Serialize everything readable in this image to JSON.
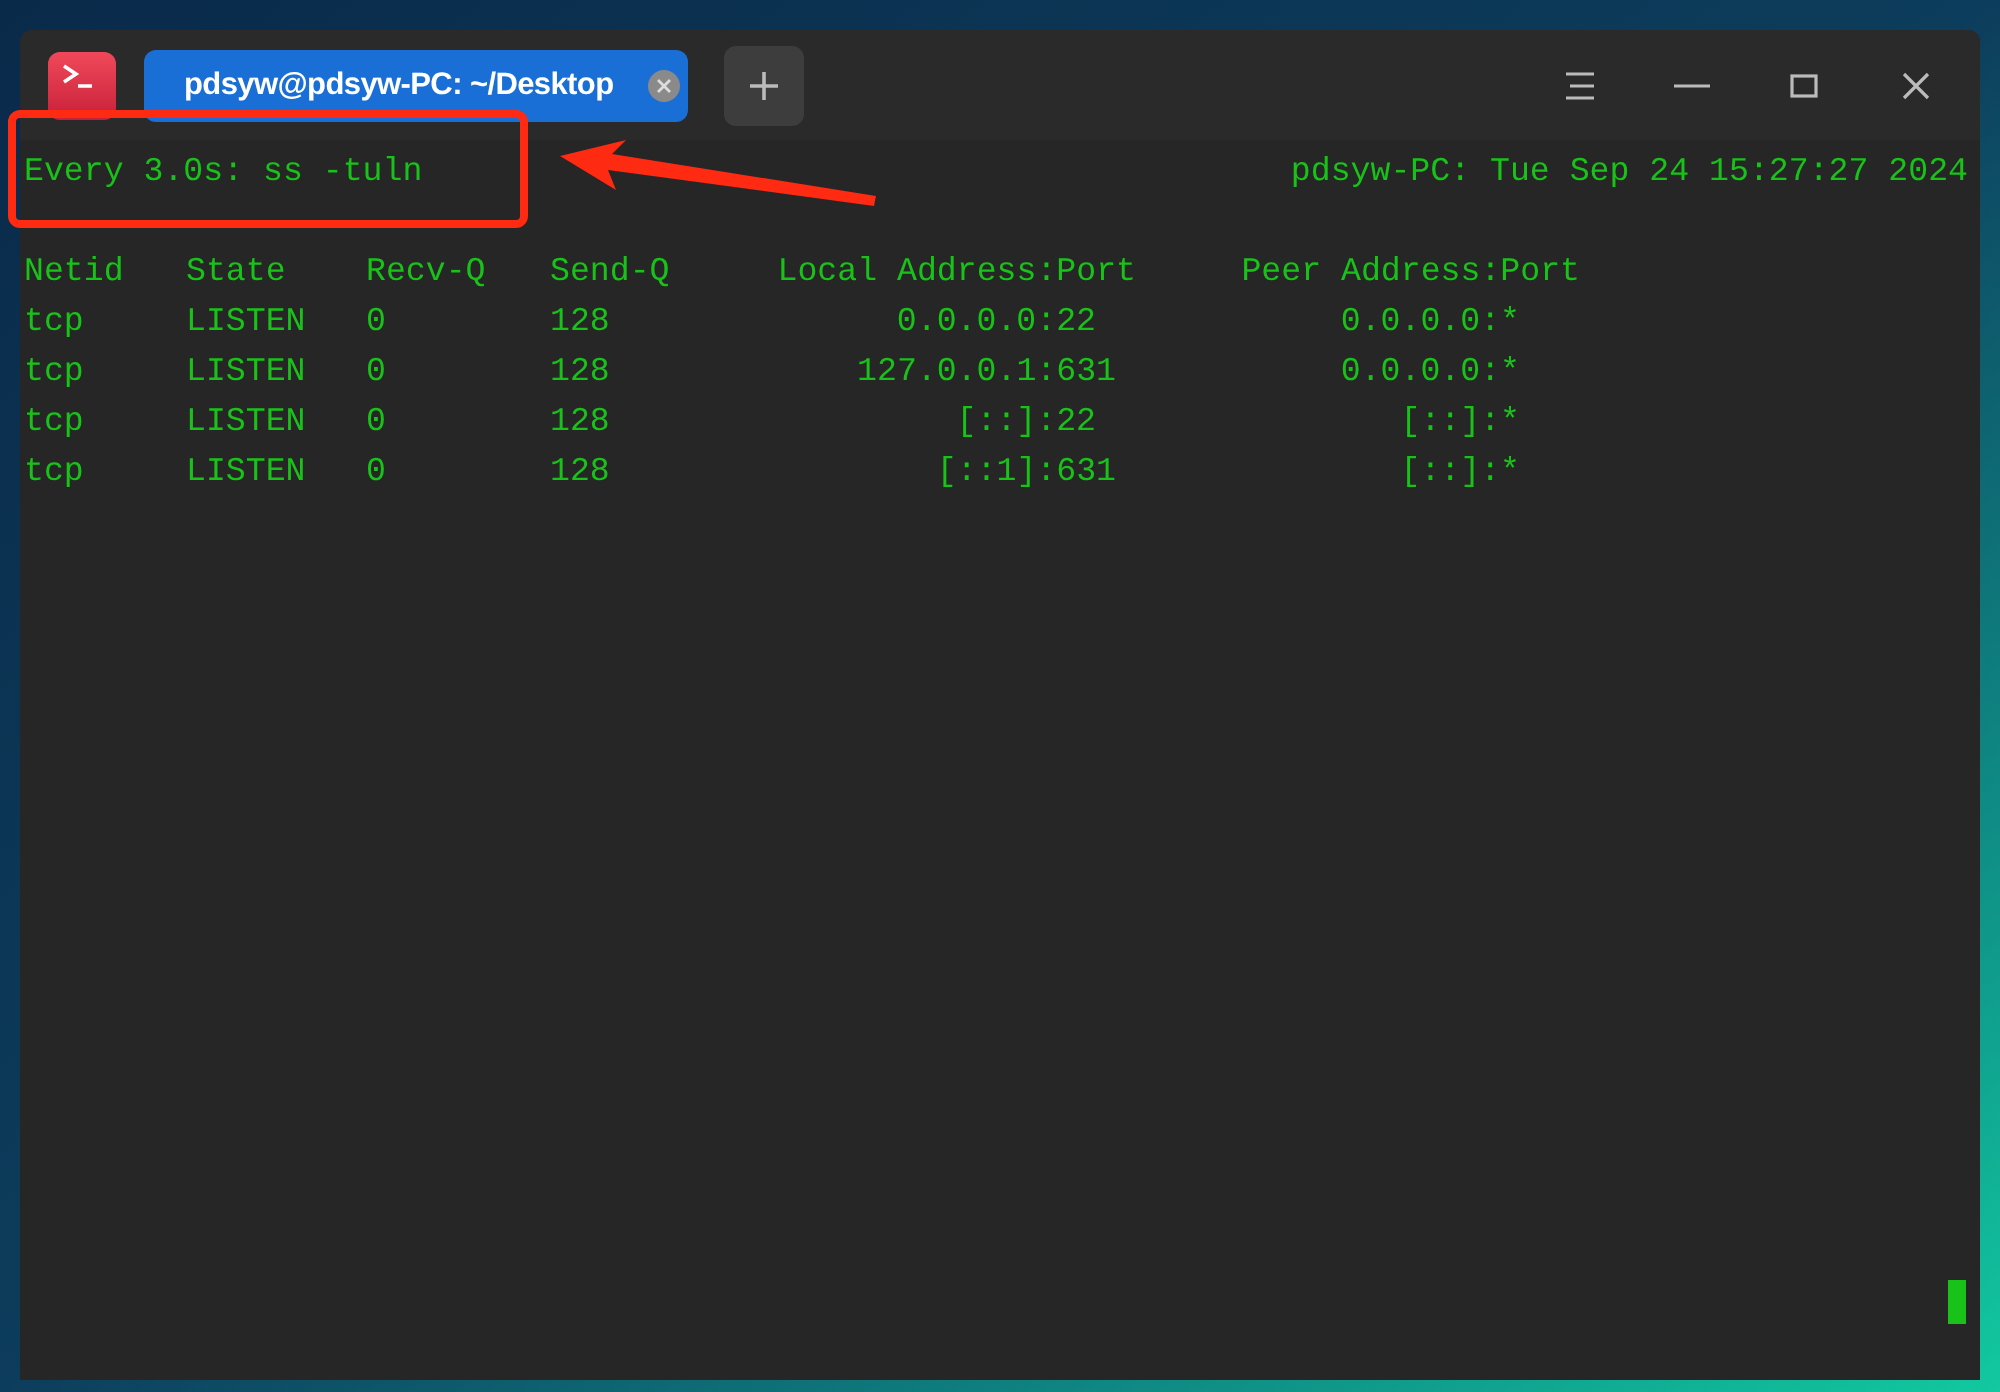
{
  "window": {
    "tabs": [
      {
        "title": "pdsyw@pdsyw-PC: ~/Desktop",
        "selected": true
      }
    ]
  },
  "terminal": {
    "watch_command": "Every 3.0s: ss -tuln",
    "host_time": "pdsyw-PC: Tue Sep 24 15:27:27 2024",
    "columns": [
      "Netid",
      "State",
      "Recv-Q",
      "Send-Q",
      "Local Address:Port",
      "Peer Address:Port"
    ],
    "rows": [
      [
        "tcp",
        "LISTEN",
        "0",
        "128",
        "0.0.0.0:22",
        "0.0.0.0:*"
      ],
      [
        "tcp",
        "LISTEN",
        "0",
        "128",
        "127.0.0.1:631",
        "0.0.0.0:*"
      ],
      [
        "tcp",
        "LISTEN",
        "0",
        "128",
        "[::]:22",
        "[::]:*"
      ],
      [
        "tcp",
        "LISTEN",
        "0",
        "128",
        "[::1]:631",
        "[::]:*"
      ]
    ]
  }
}
